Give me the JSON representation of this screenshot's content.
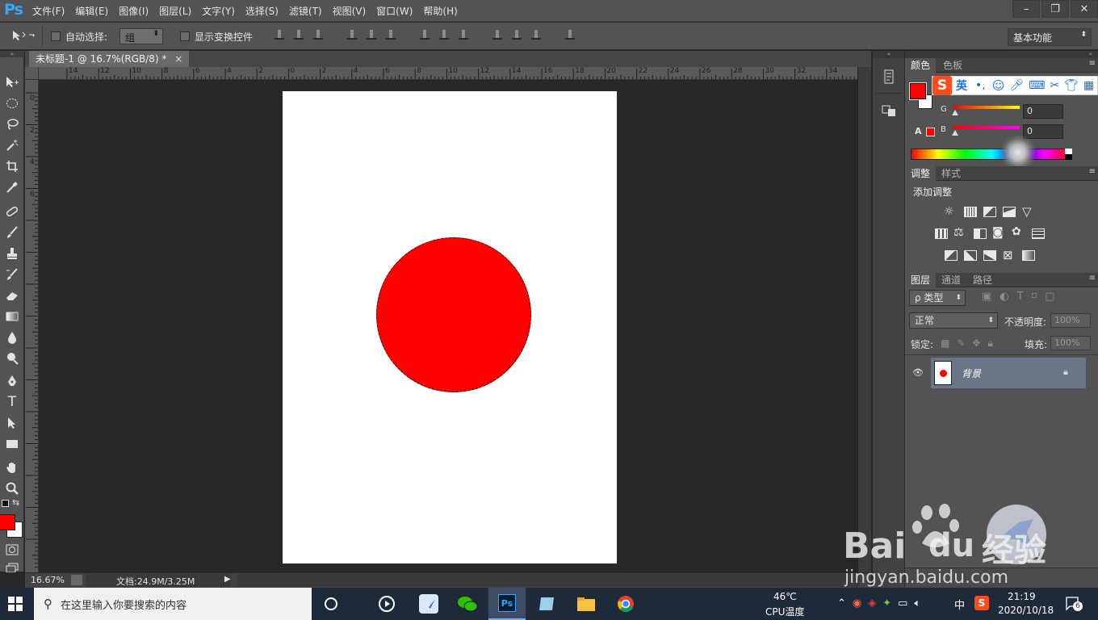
{
  "app": {
    "logo": "Ps",
    "menu": [
      "文件(F)",
      "编辑(E)",
      "图像(I)",
      "图层(L)",
      "文字(Y)",
      "选择(S)",
      "滤镜(T)",
      "视图(V)",
      "窗口(W)",
      "帮助(H)"
    ],
    "window_controls": [
      "–",
      "❐",
      "✕"
    ]
  },
  "options_bar": {
    "auto_select_label": "自动选择:",
    "auto_select_value": "组",
    "show_transform_label": "显示变换控件",
    "workspace": "基本功能"
  },
  "document": {
    "tab_title": "未标题-1 @ 16.7%(RGB/8) *",
    "tab_close": "×",
    "ruler_top_labels": [
      "14",
      "12",
      "10",
      "8",
      "6",
      "4",
      "2",
      "0",
      "2",
      "4",
      "6",
      "8",
      "10",
      "12",
      "14",
      "16",
      "18",
      "20",
      "22",
      "24",
      "26",
      "28",
      "30",
      "32",
      "34"
    ],
    "ruler_left_labels": [
      "0",
      "2",
      "4",
      "6"
    ],
    "circle_color": "#ff0000",
    "canvas_color": "#ffffff"
  },
  "status_bar": {
    "zoom": "16.67%",
    "doc_size": "文档:24.9M/3.25M"
  },
  "color_panel": {
    "tabs": [
      "颜色",
      "色板"
    ],
    "foreground": "#ff0000",
    "background": "#ffffff",
    "channels": [
      {
        "name": "G",
        "value": "0"
      },
      {
        "name": "B",
        "value": "0"
      }
    ],
    "warning_glyph": "A"
  },
  "adjustments_panel": {
    "tabs": [
      "调整",
      "样式"
    ],
    "title": "添加调整"
  },
  "layers_panel": {
    "tabs": [
      "图层",
      "通道",
      "路径"
    ],
    "filter_label": "ρ 类型",
    "blend_mode": "正常",
    "opacity_label": "不透明度:",
    "opacity_value": "100%",
    "lock_label": "锁定:",
    "fill_label": "填充:",
    "fill_value": "100%",
    "layers": [
      {
        "name": "背景",
        "locked": true,
        "visible": true
      }
    ]
  },
  "ime": {
    "mode": "英",
    "logo": "S"
  },
  "taskbar": {
    "search_placeholder": "在这里输入你要搜索的内容",
    "temperature": "46℃",
    "temperature_label": "CPU温度",
    "input_lang": "中",
    "time": "21:19",
    "date": "2020/10/18",
    "notification_count": "6"
  },
  "watermark": {
    "brand": "Bai",
    "brand2": "du",
    "brand_cn": "经验",
    "url": "jingyan.baidu.com"
  }
}
